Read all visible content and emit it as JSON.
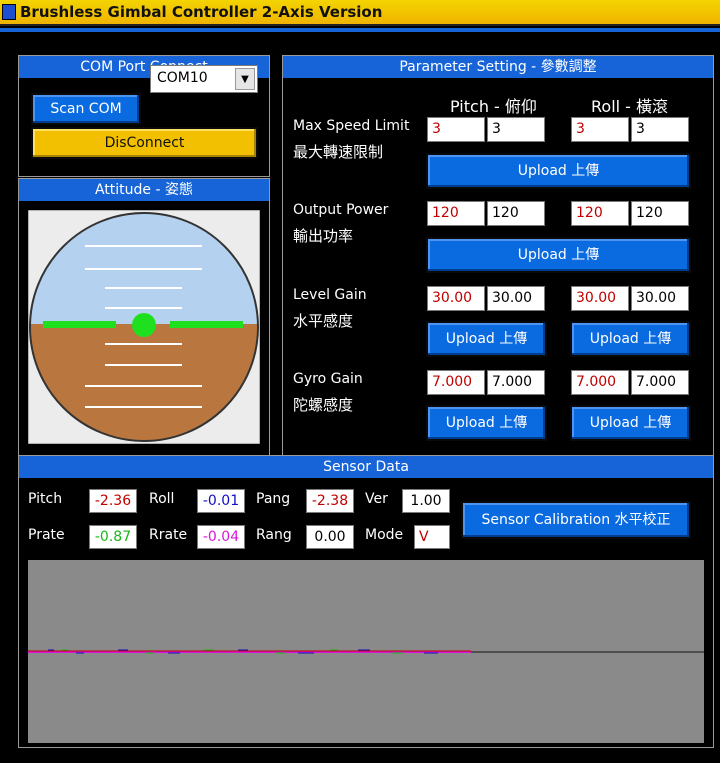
{
  "window": {
    "title": "Brushless Gimbal Controller  2-Axis Version"
  },
  "com": {
    "header": "COM Port Connect",
    "scan_label": "Scan COM",
    "port_value": "COM10",
    "disconnect_label": "DisConnect"
  },
  "attitude": {
    "header": "Attitude - 姿態"
  },
  "params": {
    "header": "Parameter Setting - 參數調整",
    "pitch_header": "Pitch - 俯仰",
    "roll_header": "Roll - 橫滾",
    "max_speed": {
      "label_en": "Max Speed Limit",
      "label_zh": "最大轉速限制",
      "pitch": [
        "3",
        "3"
      ],
      "roll": [
        "3",
        "3"
      ],
      "upload": "Upload 上傳"
    },
    "output_power": {
      "label_en": "Output Power",
      "label_zh": "輸出功率",
      "pitch": [
        "120",
        "120"
      ],
      "roll": [
        "120",
        "120"
      ],
      "upload": "Upload 上傳"
    },
    "level_gain": {
      "label_en": "Level Gain",
      "label_zh": "水平感度",
      "pitch": [
        "30.00",
        "30.00"
      ],
      "roll": [
        "30.00",
        "30.00"
      ],
      "upload_pitch": "Upload 上傳",
      "upload_roll": "Upload 上傳"
    },
    "gyro_gain": {
      "label_en": "Gyro Gain",
      "label_zh": "陀螺感度",
      "pitch": [
        "7.000",
        "7.000"
      ],
      "roll": [
        "7.000",
        "7.000"
      ],
      "upload_pitch": "Upload 上傳",
      "upload_roll": "Upload 上傳"
    }
  },
  "sensor": {
    "header": "Sensor Data",
    "pitch_label": "Pitch",
    "pitch_value": "-2.36",
    "roll_label": "Roll",
    "roll_value": "-0.01",
    "pang_label": "Pang",
    "pang_value": "-2.38",
    "ver_label": "Ver",
    "ver_value": "1.00",
    "prate_label": "Prate",
    "prate_value": "-0.87",
    "rrate_label": "Rrate",
    "rrate_value": "-0.04",
    "rang_label": "Rang",
    "rang_value": "0.00",
    "mode_label": "Mode",
    "mode_value": "V",
    "calibration_label": "Sensor Calibration 水平校正"
  },
  "colors": {
    "accent_blue": "#1664d8",
    "title_yellow": "#f2c000",
    "value_red": "#c00000",
    "value_blue": "#1010c0",
    "value_green": "#18b818",
    "value_magenta": "#d818d8",
    "sky": "#b4d2f0",
    "ground": "#b9773f",
    "horizon_green": "#1fe01f"
  }
}
